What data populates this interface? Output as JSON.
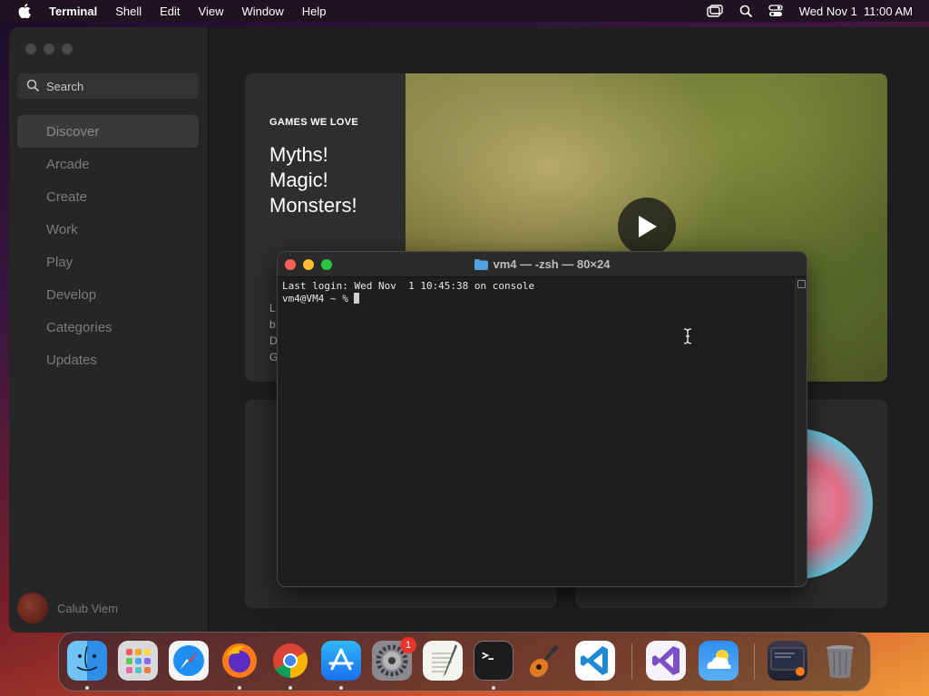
{
  "menubar": {
    "app": "Terminal",
    "menus": [
      "Shell",
      "Edit",
      "View",
      "Window",
      "Help"
    ],
    "clock": "Wed Nov 1  11:00 AM"
  },
  "appstore": {
    "search_placeholder": "Search",
    "nav": [
      "Discover",
      "Arcade",
      "Create",
      "Work",
      "Play",
      "Develop",
      "Categories",
      "Updates"
    ],
    "active_nav": "Discover",
    "user_name": "Calub Viem",
    "feature": {
      "eyebrow": "GAMES WE LOVE",
      "headline_lines": [
        "Myths!",
        "Magic!",
        "Monsters!"
      ],
      "snippet_lines": [
        "L",
        "b",
        "D",
        "G"
      ]
    }
  },
  "terminal": {
    "title": "vm4 — -zsh — 80×24",
    "lines": [
      "Last login: Wed Nov  1 10:45:38 on console",
      "vm4@VM4 ~ % "
    ]
  },
  "dock": {
    "apps": [
      "Finder",
      "Launchpad",
      "Safari",
      "Firefox",
      "Chrome",
      "App Store",
      "System Settings",
      "TextEdit",
      "Terminal",
      "GarageBand",
      "Visual Studio Code",
      "Visual Studio",
      "Weather",
      "Downloads",
      "Trash"
    ],
    "settings_badge": "1"
  },
  "colors": {
    "traffic_red": "#ff5f57",
    "traffic_yellow": "#febc2e",
    "traffic_green": "#28c840",
    "badge_red": "#e8352c"
  }
}
